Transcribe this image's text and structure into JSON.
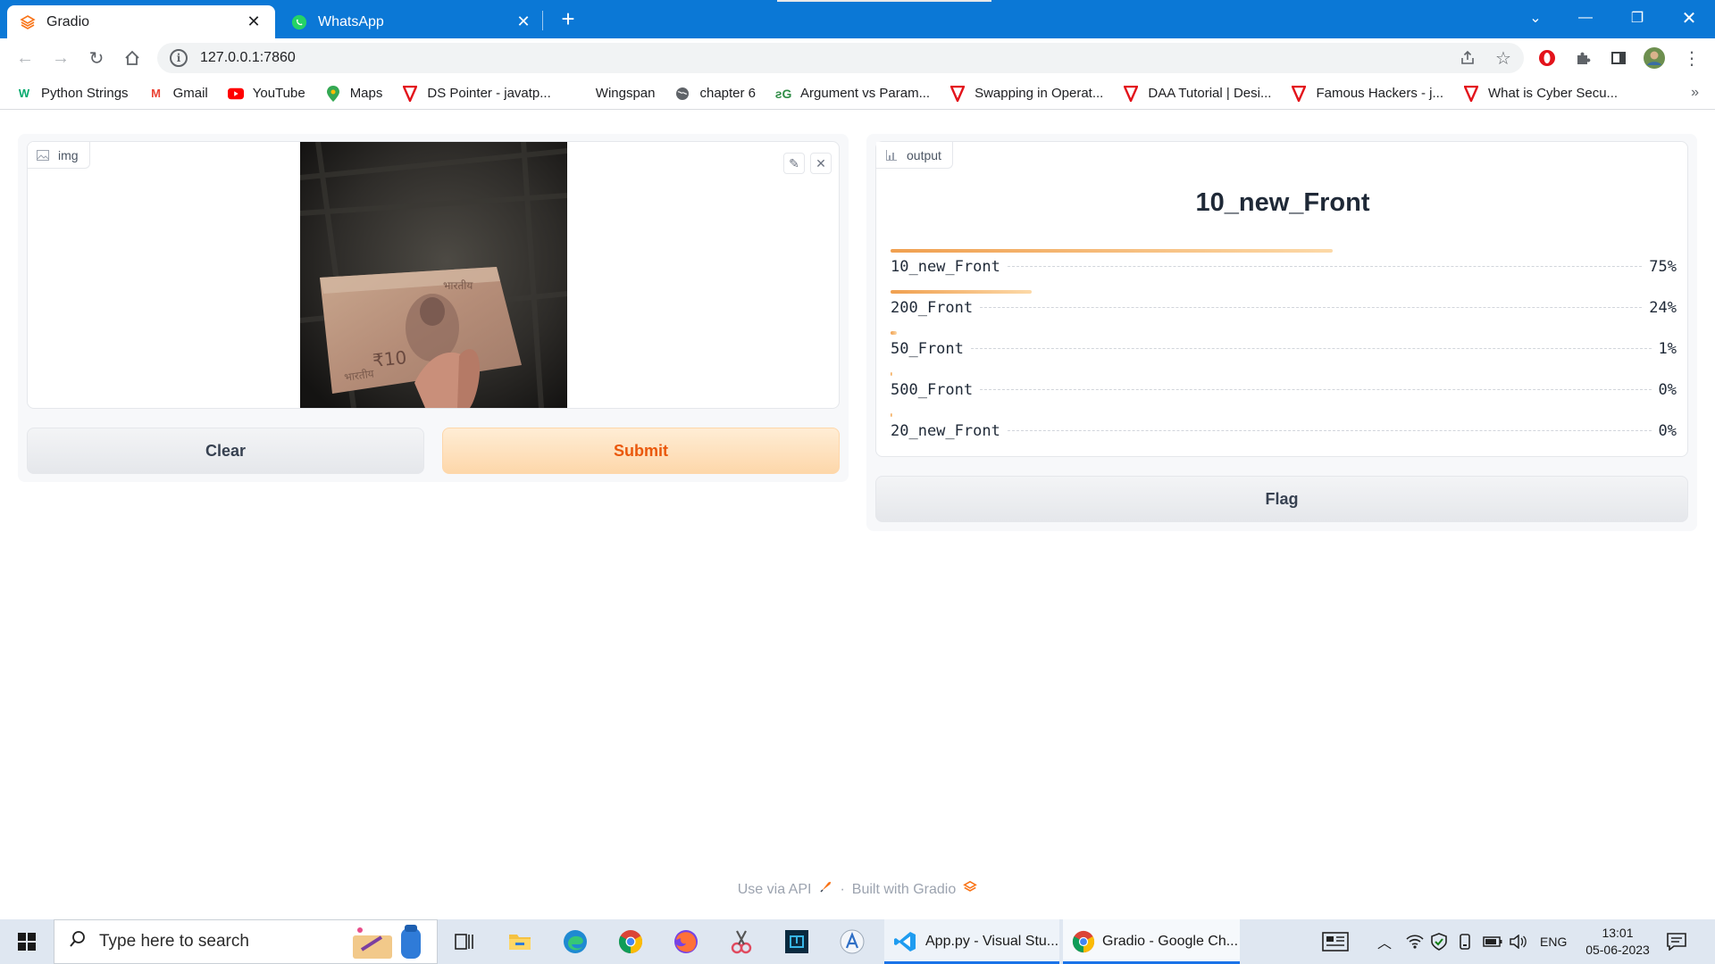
{
  "browser": {
    "tabs": [
      {
        "title": "Gradio",
        "active": true,
        "icon": "gradio-icon"
      },
      {
        "title": "WhatsApp",
        "active": false,
        "icon": "whatsapp-icon"
      }
    ],
    "url": "127.0.0.1:7860",
    "bookmarks": [
      {
        "label": "Python Strings",
        "icon": "w3schools-icon"
      },
      {
        "label": "Gmail",
        "icon": "gmail-icon"
      },
      {
        "label": "YouTube",
        "icon": "youtube-icon"
      },
      {
        "label": "Maps",
        "icon": "maps-icon"
      },
      {
        "label": "DS Pointer - javatp...",
        "icon": "javatpoint-icon"
      },
      {
        "label": "Wingspan",
        "icon": "blank-icon"
      },
      {
        "label": "chapter 6",
        "icon": "globe-icon"
      },
      {
        "label": "Argument vs Param...",
        "icon": "geeks-icon"
      },
      {
        "label": "Swapping in Operat...",
        "icon": "javatpoint-icon"
      },
      {
        "label": "DAA Tutorial | Desi...",
        "icon": "javatpoint-icon"
      },
      {
        "label": "Famous Hackers - j...",
        "icon": "javatpoint-icon"
      },
      {
        "label": "What is Cyber Secu...",
        "icon": "javatpoint-icon"
      }
    ]
  },
  "input": {
    "label": "img",
    "clear_label": "Clear",
    "submit_label": "Submit"
  },
  "output": {
    "label": "output",
    "top_class": "10_new_Front",
    "confidences": [
      {
        "label": "10_new_Front",
        "value": 0.75,
        "pct": "75%"
      },
      {
        "label": "200_Front",
        "value": 0.24,
        "pct": "24%"
      },
      {
        "label": "50_Front",
        "value": 0.01,
        "pct": "1%"
      },
      {
        "label": "500_Front",
        "value": 0.0,
        "pct": "0%"
      },
      {
        "label": "20_new_Front",
        "value": 0.0,
        "pct": "0%"
      }
    ],
    "flag_label": "Flag"
  },
  "footer": {
    "api_label": "Use via API",
    "separator": "·",
    "built_label": "Built with Gradio"
  },
  "taskbar": {
    "search_placeholder": "Type here to search",
    "windows": [
      {
        "title": "App.py - Visual Stu...",
        "icon": "vscode-icon"
      },
      {
        "title": "Gradio - Google Ch...",
        "icon": "chrome-icon"
      }
    ],
    "language": "ENG",
    "time": "13:01",
    "date": "05-06-2023"
  },
  "colors": {
    "chrome_blue": "#0b78d6",
    "gradio_orange": "#ea580c",
    "bar_start": "#f0a050",
    "bar_end": "#fcd9a8"
  }
}
